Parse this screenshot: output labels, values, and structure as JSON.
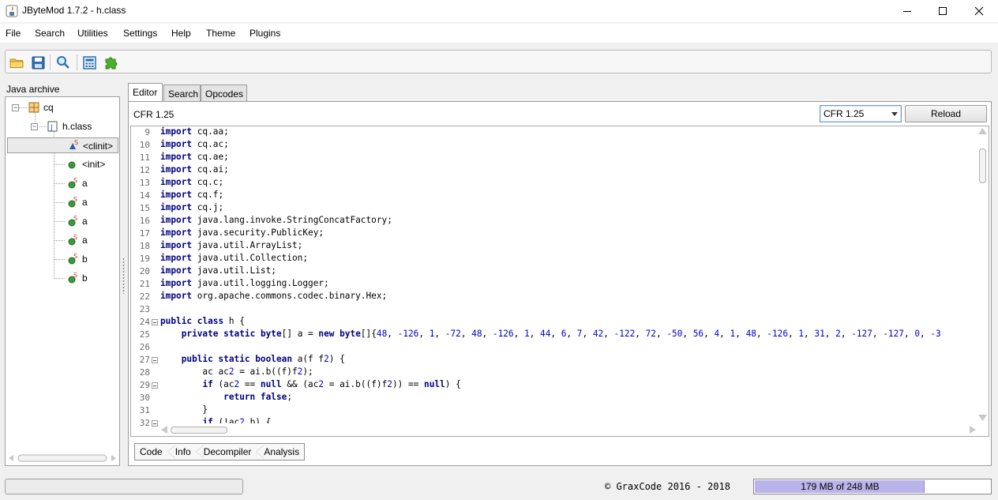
{
  "window": {
    "title": "JByteMod 1.7.2 - h.class",
    "icons": {
      "app": "java-cup-icon",
      "minimize": "minimize-icon",
      "maximize": "maximize-icon",
      "close": "close-icon"
    }
  },
  "menu": [
    "File",
    "Search",
    "Utilities",
    "Settings",
    "Help",
    "Theme",
    "Plugins"
  ],
  "toolbar": {
    "buttons": [
      "open-folder-icon",
      "save-icon",
      "search-icon",
      "calculator-icon",
      "plugin-puzzle-icon"
    ]
  },
  "sidebar": {
    "title": "Java archive",
    "tree": [
      {
        "label": "cq",
        "icon": "package-icon",
        "level": 0,
        "expanded": true
      },
      {
        "label": "h.class",
        "icon": "class-file-icon",
        "level": 1,
        "expanded": true
      },
      {
        "label": "<clinit>",
        "icon": "static-init-icon",
        "level": 2,
        "selected": true
      },
      {
        "label": "<init>",
        "icon": "method-icon",
        "level": 2
      },
      {
        "label": "a",
        "icon": "static-method-icon",
        "level": 2
      },
      {
        "label": "a",
        "icon": "static-method-icon",
        "level": 2
      },
      {
        "label": "a",
        "icon": "static-method-icon",
        "level": 2
      },
      {
        "label": "a",
        "icon": "static-method-icon",
        "level": 2
      },
      {
        "label": "b",
        "icon": "static-method-icon",
        "level": 2
      },
      {
        "label": "b",
        "icon": "static-method-icon",
        "level": 2
      }
    ]
  },
  "tabs": [
    "Editor",
    "Search",
    "Opcodes"
  ],
  "active_tab": "Editor",
  "editor": {
    "decompiler_label": "CFR 1.25",
    "decompiler_selected": "CFR 1.25",
    "reload_label": "Reload",
    "code_lines": [
      {
        "n": "9",
        "text": "import cq.aa;"
      },
      {
        "n": "10",
        "text": "import cq.ac;"
      },
      {
        "n": "11",
        "text": "import cq.ae;"
      },
      {
        "n": "12",
        "text": "import cq.ai;"
      },
      {
        "n": "13",
        "text": "import cq.c;"
      },
      {
        "n": "14",
        "text": "import cq.f;"
      },
      {
        "n": "15",
        "text": "import cq.j;"
      },
      {
        "n": "16",
        "text": "import java.lang.invoke.StringConcatFactory;"
      },
      {
        "n": "17",
        "text": "import java.security.PublicKey;"
      },
      {
        "n": "18",
        "text": "import java.util.ArrayList;"
      },
      {
        "n": "19",
        "text": "import java.util.Collection;"
      },
      {
        "n": "20",
        "text": "import java.util.List;"
      },
      {
        "n": "21",
        "text": "import java.util.logging.Logger;"
      },
      {
        "n": "22",
        "text": "import org.apache.commons.codec.binary.Hex;"
      },
      {
        "n": "23",
        "text": ""
      },
      {
        "n": "24",
        "text": "public class h {",
        "fold": true
      },
      {
        "n": "25",
        "text": "    private static byte[] a = new byte[]{48, -126, 1, -72, 48, -126, 1, 44, 6, 7, 42, -122, 72, -50, 56, 4, 1, 48, -126, 1, 31, 2, -127, -127, 0, -3"
      },
      {
        "n": "26",
        "text": ""
      },
      {
        "n": "27",
        "text": "    public static boolean a(f f2) {",
        "fold": true
      },
      {
        "n": "28",
        "text": "        ac ac2 = ai.b((f)f2);"
      },
      {
        "n": "29",
        "text": "        if (ac2 == null && (ac2 = ai.b((f)f2)) == null) {",
        "fold": true
      },
      {
        "n": "30",
        "text": "            return false;"
      },
      {
        "n": "31",
        "text": "        }"
      },
      {
        "n": "32",
        "text": "        if (!ac2.b) {",
        "fold": true
      }
    ]
  },
  "bottom_tabs": [
    "Code",
    "Info",
    "Decompiler",
    "Analysis"
  ],
  "status": {
    "copyright": "© GraxCode 2016 - 2018",
    "memory_text": "179 MB of 248 MB",
    "memory_used_mb": 179,
    "memory_total_mb": 248
  }
}
